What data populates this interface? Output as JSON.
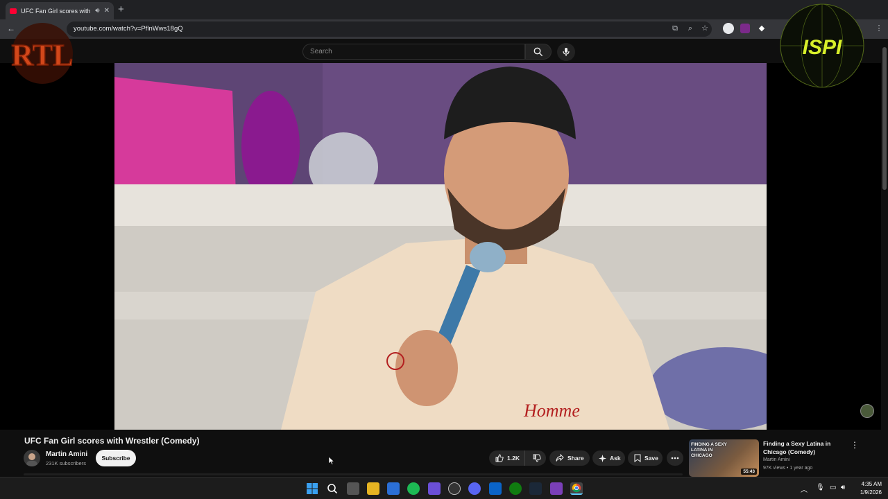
{
  "browser": {
    "tab_title": "UFC Fan Girl scores with W",
    "url": "youtube.com/watch?v=PflnWws18gQ"
  },
  "youtube": {
    "search_placeholder": "Search"
  },
  "video": {
    "title": "UFC Fan Girl scores with Wrestler (Comedy)",
    "channel_name": "Martin Amini",
    "subscriber_count": "231K subscribers",
    "subscribe_label": "Subscribe",
    "like_count": "1.2K",
    "share_label": "Share",
    "ask_label": "Ask",
    "save_label": "Save"
  },
  "recommended": {
    "title": "Finding a Sexy Latina in Chicago (Comedy)",
    "channel": "Martin Amini",
    "meta": "97K views • 1 year ago",
    "duration": "55:43",
    "thumb_text": "FINDING A SEXY LATINA IN CHICAGO"
  },
  "overlays": {
    "left_logo_text": "RTL",
    "right_logo_text": "ISPI"
  },
  "taskbar": {
    "time": "4:35 AM",
    "date": "1/9/2026"
  },
  "colors": {
    "youtube_red": "#ff0033",
    "bg": "#0f0f0f",
    "pill_bg": "#272727"
  }
}
